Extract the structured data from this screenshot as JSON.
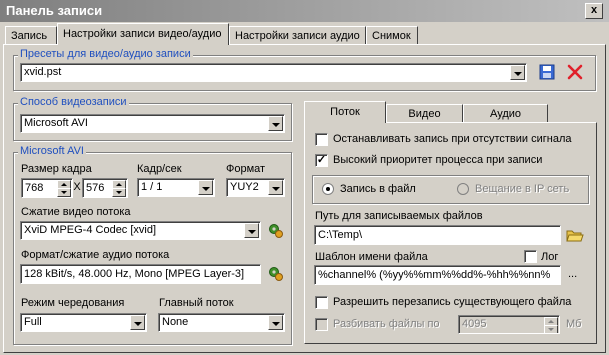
{
  "window": {
    "title": "Панель записи",
    "close_glyph": "x"
  },
  "tabs": [
    {
      "label": "Запись"
    },
    {
      "label": "Настройки записи видео/аудио"
    },
    {
      "label": "Настройки записи аудио"
    },
    {
      "label": "Снимок"
    }
  ],
  "presets": {
    "legend": "Пресеты для видео/аудио записи",
    "value": "xvid.pst"
  },
  "capture_method": {
    "legend": "Способ видеозаписи",
    "value": "Microsoft AVI"
  },
  "avi": {
    "legend": "Microsoft AVI",
    "frame_size_label": "Размер кадра",
    "width": "768",
    "x_sep": "X",
    "height": "576",
    "fps_label": "Кадр/сек",
    "fps": "1 / 1",
    "format_label": "Формат",
    "format": "YUY2",
    "video_compression_label": "Сжатие видео потока",
    "video_codec": "XviD MPEG-4 Codec [xvid]",
    "audio_format_label": "Формат/сжатие аудио потока",
    "audio_format": "128 kBit/s, 48.000 Hz, Mono [MPEG Layer-3]",
    "interleave_label": "Режим чередования",
    "interleave": "Full",
    "master_stream_label": "Главный поток",
    "master_stream": "None"
  },
  "subtabs": [
    {
      "label": "Поток"
    },
    {
      "label": "Видео"
    },
    {
      "label": "Аудио"
    }
  ],
  "stream": {
    "stop_on_no_signal": {
      "label": "Останавливать запись при отсутствии сигнала",
      "checked": false
    },
    "high_priority": {
      "label": "Высокий приоритет процесса при записи",
      "checked": true,
      "mark": "✓"
    },
    "record_to_file": "Запись в файл",
    "broadcast_ip": "Вещание в IP сеть",
    "path_label": "Путь для записываемых файлов",
    "path_value": "C:\\Temp\\",
    "template_label": "Шаблон имени файла",
    "log_label": "Лог",
    "template_value": "%channel% (%yy%%mm%%dd%-%hh%%nn%",
    "template_more": "...",
    "allow_overwrite": {
      "label": "Разрешить перезапись существующего файла",
      "checked": false
    },
    "split_files": {
      "label": "Разбивать файлы по",
      "checked": false
    },
    "split_size": "4095",
    "split_unit": "Мб"
  },
  "colors": {
    "legend_blue": "#1f4fbf",
    "delete_red": "#e0202a"
  }
}
